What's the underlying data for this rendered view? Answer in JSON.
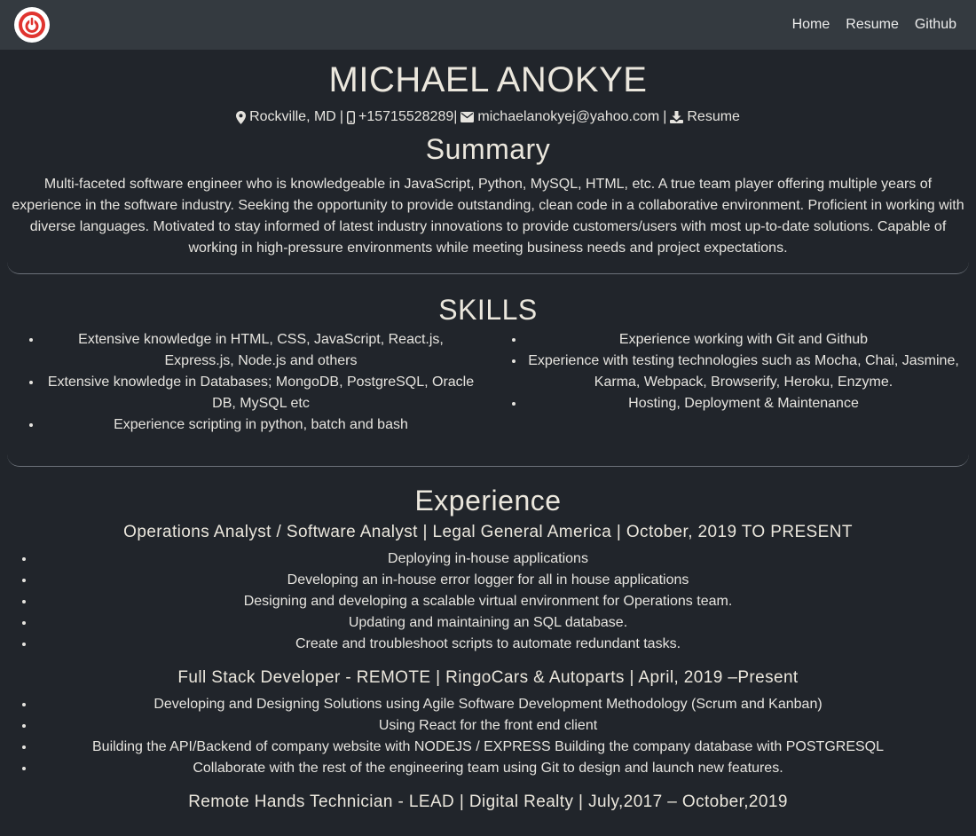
{
  "nav": {
    "logo_icon": "power-logo-icon",
    "links": [
      "Home",
      "Resume",
      "Github"
    ]
  },
  "header": {
    "name": "MICHAEL ANOKYE",
    "location": "Rockville, MD",
    "phone": "+15715528289",
    "email": "michaelanokyej@yahoo.com",
    "resume_link": "Resume",
    "sep1": "|",
    "sep2": "|",
    "sep3": "|"
  },
  "summary": {
    "title": "Summary",
    "text": "Multi-faceted software engineer who is knowledgeable in JavaScript, Python, MySQL, HTML, etc. A true team player offering multiple years of experience in the software industry. Seeking the opportunity to provide outstanding, clean code in a collaborative environment. Proficient in working with diverse languages. Motivated to stay informed of latest industry innovations to provide customers/users with most up-to-date solutions. Capable of working in high-pressure environments while meeting business needs and project expectations."
  },
  "skills": {
    "title": "SKILLS",
    "left": [
      "Extensive knowledge in HTML, CSS, JavaScript, React.js, Express.js, Node.js and others",
      "Extensive knowledge in Databases; MongoDB, PostgreSQL, Oracle DB, MySQL etc",
      "Experience scripting in python, batch and bash"
    ],
    "right": [
      "Experience working with Git and Github",
      "Experience with testing technologies such as Mocha, Chai, Jasmine, Karma, Webpack, Browserify, Heroku, Enzyme.",
      "Hosting, Deployment & Maintenance"
    ]
  },
  "experience": {
    "title": "Experience",
    "jobs": [
      {
        "title": "Operations Analyst / Software Analyst | Legal General America | October, 2019 TO PRESENT",
        "items": [
          "Deploying in-house applications",
          "Developing an in-house error logger for all in house applications",
          "Designing and developing a scalable virtual environment for Operations team.",
          "Updating and maintaining an SQL database.",
          "Create and troubleshoot scripts to automate redundant tasks."
        ]
      },
      {
        "title": "Full Stack Developer - REMOTE | RingoCars & Autoparts | April, 2019 –Present",
        "items": [
          "Developing and Designing Solutions using Agile Software Development Methodology (Scrum and Kanban)",
          "Using React for the front end client",
          "Building the API/Backend of company website with NODEJS / EXPRESS Building the company database with POSTGRESQL",
          "Collaborate with the rest of the engineering team using Git to design and launch new features."
        ]
      },
      {
        "title": "Remote Hands Technician - LEAD | Digital Realty | July,2017 – October,2019",
        "items": []
      }
    ]
  }
}
